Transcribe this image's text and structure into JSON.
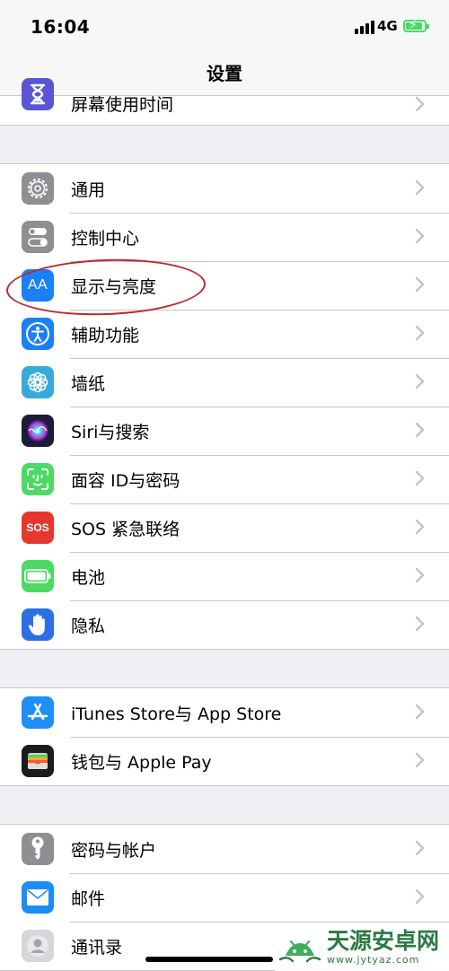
{
  "status": {
    "time": "16:04",
    "network": "4G"
  },
  "nav": {
    "title": "设置"
  },
  "groups": [
    {
      "rows": [
        {
          "label": "屏幕使用时间",
          "icon": "hourglass-icon",
          "color": "#5856d6"
        }
      ]
    },
    {
      "rows": [
        {
          "label": "通用",
          "icon": "gear-icon",
          "color": "#8e8e93"
        },
        {
          "label": "控制中心",
          "icon": "toggles-icon",
          "color": "#8e8e93"
        },
        {
          "label": "显示与亮度",
          "icon": "text-size-icon",
          "icon_text": "AA",
          "color": "#1b7ff5"
        },
        {
          "label": "辅助功能",
          "icon": "accessibility-icon",
          "color": "#1b7ff5"
        },
        {
          "label": "墙纸",
          "icon": "flower-icon",
          "color": "#37aadc"
        },
        {
          "label": "Siri与搜索",
          "icon": "siri-icon",
          "color": "#1c1c3a"
        },
        {
          "label": "面容 ID与密码",
          "icon": "face-id-icon",
          "color": "#4cd964"
        },
        {
          "label": "SOS 紧急联络",
          "icon": "sos-icon",
          "icon_text": "SOS",
          "color": "#e5372f"
        },
        {
          "label": "电池",
          "icon": "battery-icon",
          "color": "#4cd964"
        },
        {
          "label": "隐私",
          "icon": "hand-icon",
          "color": "#2c6fe3"
        }
      ]
    },
    {
      "rows": [
        {
          "label": "iTunes Store与 App Store",
          "icon": "app-store-icon",
          "color": "#1f8ef5"
        },
        {
          "label": "钱包与 Apple Pay",
          "icon": "wallet-icon",
          "color": "#1c1c1e"
        }
      ]
    },
    {
      "rows": [
        {
          "label": "密码与帐户",
          "icon": "key-icon",
          "color": "#8e8e93"
        },
        {
          "label": "邮件",
          "icon": "mail-icon",
          "color": "#1b8df7"
        },
        {
          "label": "通讯录",
          "icon": "contacts-icon",
          "color": "#c7c7cc"
        }
      ]
    }
  ],
  "highlight": {
    "target": "显示与亮度",
    "color": "#c0252b"
  },
  "watermark": {
    "title": "天源安卓网",
    "url": "www.jytyaz.com"
  }
}
